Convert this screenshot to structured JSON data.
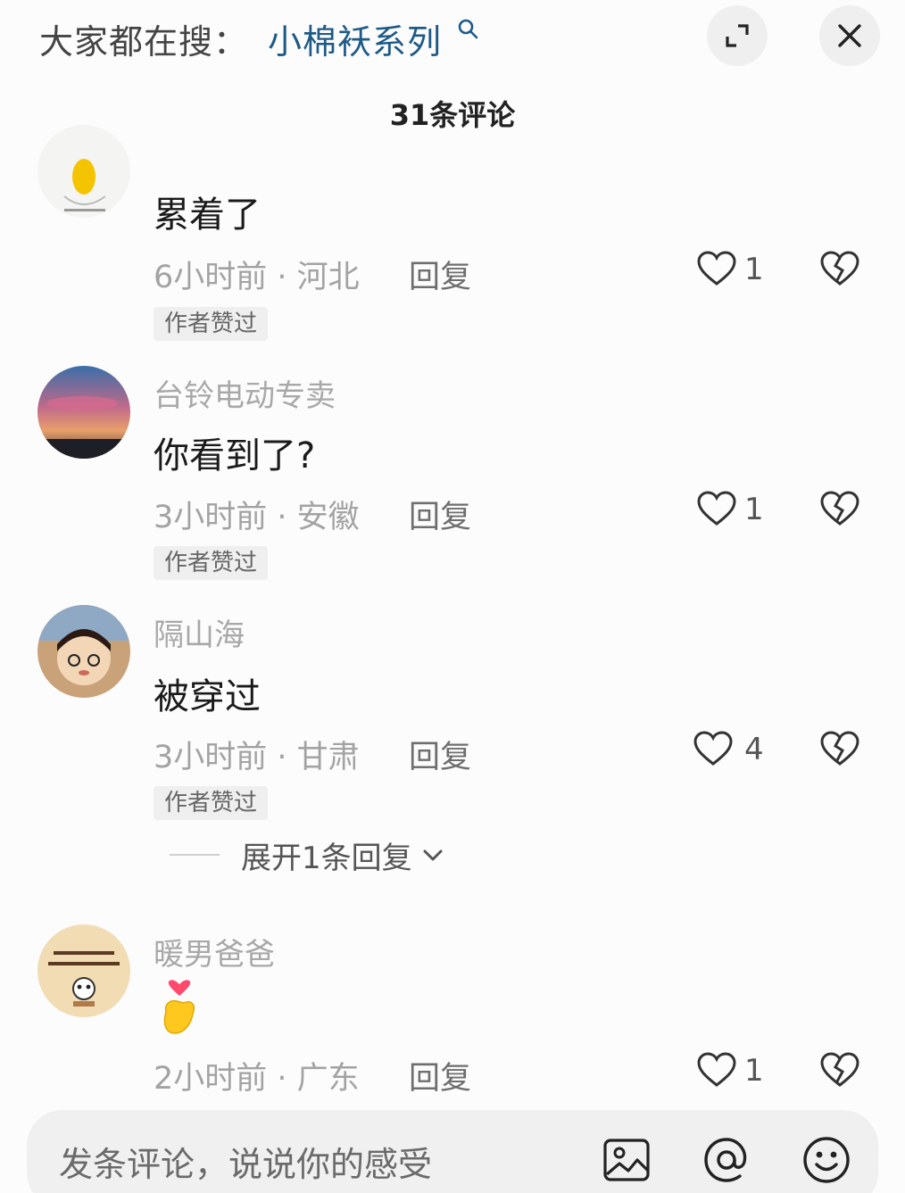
{
  "header": {
    "search_prefix": "大家都在搜：",
    "search_term": "小棉袄系列",
    "comment_count": "31条评论"
  },
  "comments": [
    {
      "username": "",
      "text": "累着了",
      "time": "6小时前",
      "location": "河北",
      "reply": "回复",
      "likes": "1",
      "badge": "作者赞过"
    },
    {
      "username": "台铃电动专卖",
      "text": "你看到了?",
      "time": "3小时前",
      "location": "安徽",
      "reply": "回复",
      "likes": "1",
      "badge": "作者赞过"
    },
    {
      "username": "隔山海",
      "text": "被穿过",
      "time": "3小时前",
      "location": "甘肃",
      "reply": "回复",
      "likes": "4",
      "badge": "作者赞过",
      "expand_replies": "展开1条回复"
    },
    {
      "username": "暖男爸爸",
      "text": "",
      "time": "2小时前",
      "location": "广东",
      "reply": "回复",
      "likes": "1"
    }
  ],
  "input": {
    "placeholder": "发条评论，说说你的感受"
  },
  "meta_separator": " · ",
  "icons": {
    "expand": "expand-icon",
    "close": "close-icon",
    "like": "heart-icon",
    "dislike": "broken-heart-icon",
    "image": "image-icon",
    "mention": "at-icon",
    "emoji": "emoji-icon",
    "reaction": "finger-heart-emoji"
  },
  "colors": {
    "search_link": "#1e5a86",
    "muted_text": "#a3a3a3",
    "badge_bg": "#efefef"
  }
}
